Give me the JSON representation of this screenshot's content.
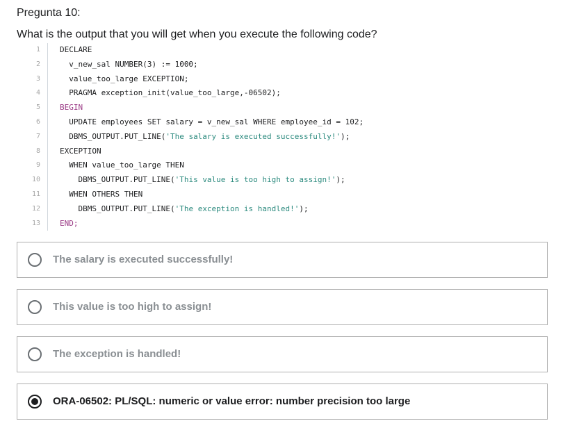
{
  "question": {
    "number_label": "Pregunta 10:",
    "text": "What is the output that you will get when you execute the following code?"
  },
  "code_lines": [
    {
      "num": "1",
      "indent": "",
      "parts": [
        {
          "t": "DECLARE",
          "c": ""
        }
      ]
    },
    {
      "num": "2",
      "indent": "  ",
      "parts": [
        {
          "t": "v_new_sal NUMBER(3) := 1000;",
          "c": ""
        }
      ]
    },
    {
      "num": "3",
      "indent": "  ",
      "parts": [
        {
          "t": "value_too_large EXCEPTION;",
          "c": ""
        }
      ]
    },
    {
      "num": "4",
      "indent": "  ",
      "parts": [
        {
          "t": "PRAGMA exception_init(value_too_large,-06502);",
          "c": ""
        }
      ]
    },
    {
      "num": "5",
      "indent": "",
      "parts": [
        {
          "t": "BEGIN",
          "c": "kw-begin"
        }
      ]
    },
    {
      "num": "6",
      "indent": "  ",
      "parts": [
        {
          "t": "UPDATE employees SET salary = v_new_sal WHERE employee_id = 102;",
          "c": ""
        }
      ]
    },
    {
      "num": "7",
      "indent": "  ",
      "parts": [
        {
          "t": "DBMS_OUTPUT.PUT_LINE(",
          "c": ""
        },
        {
          "t": "'The salary is executed successfully!'",
          "c": "str"
        },
        {
          "t": ");",
          "c": ""
        }
      ]
    },
    {
      "num": "8",
      "indent": "",
      "parts": [
        {
          "t": "EXCEPTION",
          "c": ""
        }
      ]
    },
    {
      "num": "9",
      "indent": "  ",
      "parts": [
        {
          "t": "WHEN value_too_large THEN",
          "c": ""
        }
      ]
    },
    {
      "num": "10",
      "indent": "    ",
      "parts": [
        {
          "t": "DBMS_OUTPUT.PUT_LINE(",
          "c": ""
        },
        {
          "t": "'This value is too high to assign!'",
          "c": "str"
        },
        {
          "t": ");",
          "c": ""
        }
      ]
    },
    {
      "num": "11",
      "indent": "  ",
      "parts": [
        {
          "t": "WHEN OTHERS THEN",
          "c": ""
        }
      ]
    },
    {
      "num": "12",
      "indent": "    ",
      "parts": [
        {
          "t": "DBMS_OUTPUT.PUT_LINE(",
          "c": ""
        },
        {
          "t": "'The exception is handled!'",
          "c": "str"
        },
        {
          "t": ");",
          "c": ""
        }
      ]
    },
    {
      "num": "13",
      "indent": "",
      "parts": [
        {
          "t": "END;",
          "c": "kw-end"
        }
      ]
    }
  ],
  "options": [
    {
      "label": "The salary is executed successfully!",
      "selected": false
    },
    {
      "label": "This value is too high to assign!",
      "selected": false
    },
    {
      "label": "The exception is handled!",
      "selected": false
    },
    {
      "label": "ORA-06502: PL/SQL: numeric or value error: number precision too large",
      "selected": true
    }
  ],
  "colors": {
    "string_literal": "#2b8a7e",
    "keyword_block": "#9b3b86",
    "option_border": "#aeaeae",
    "unselected_text": "#8a8f93",
    "selected_text": "#1c1d1f"
  }
}
